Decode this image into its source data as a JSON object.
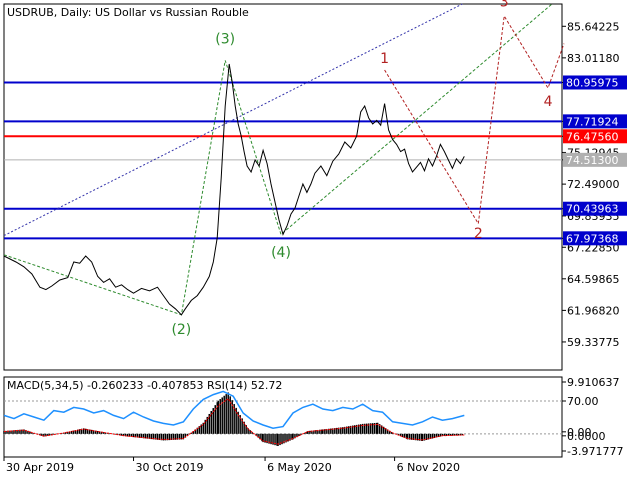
{
  "header": {
    "title": "USDRUB, Daily:  US Dollar vs Russian Rouble"
  },
  "colors": {
    "background": "#ffffff",
    "price_line": "#000000",
    "level_blue": "#0000cc",
    "level_red": "#ff0000",
    "current_grey": "#b0b0b0",
    "wave_green": "#2e8b2e",
    "wave_red": "#b22222",
    "channel_purple": "#3333aa",
    "rsi_blue": "#1e90ff",
    "macd_hist": "#000000",
    "macd_signal": "#ff0000"
  },
  "chart_data": [
    {
      "type": "line",
      "name": "price",
      "ylim": [
        57.0,
        87.5
      ],
      "x_ticks": [
        "30 Apr 2019",
        "30 Oct 2019",
        "6 May 2020",
        "6 Nov 2020"
      ],
      "y_ticks": [
        85.64225,
        83.0118,
        80.95975,
        77.71924,
        76.4756,
        75.12945,
        74.513,
        72.49,
        70.43963,
        69.83935,
        67.97368,
        67.2285,
        64.59865,
        61.9682,
        59.33775
      ],
      "series": [
        {
          "values": [
            [
              0,
              66.5
            ],
            [
              12,
              66.0
            ],
            [
              20,
              65.6
            ],
            [
              28,
              65.0
            ],
            [
              36,
              63.9
            ],
            [
              42,
              63.7
            ],
            [
              48,
              64.0
            ],
            [
              56,
              64.5
            ],
            [
              64,
              64.7
            ],
            [
              70,
              66.0
            ],
            [
              76,
              65.9
            ],
            [
              82,
              66.5
            ],
            [
              88,
              66.0
            ],
            [
              94,
              64.8
            ],
            [
              100,
              64.3
            ],
            [
              106,
              64.6
            ],
            [
              112,
              63.9
            ],
            [
              118,
              64.1
            ],
            [
              124,
              63.7
            ],
            [
              130,
              63.4
            ],
            [
              138,
              63.8
            ],
            [
              146,
              63.6
            ],
            [
              154,
              63.9
            ],
            [
              160,
              63.2
            ],
            [
              166,
              62.5
            ],
            [
              172,
              62.1
            ],
            [
              178,
              61.6
            ],
            [
              182,
              62.1
            ],
            [
              188,
              62.8
            ],
            [
              194,
              63.2
            ],
            [
              200,
              63.9
            ],
            [
              206,
              64.8
            ],
            [
              210,
              66.0
            ],
            [
              214,
              68.0
            ],
            [
              218,
              73.0
            ],
            [
              222,
              79.0
            ],
            [
              226,
              82.5
            ],
            [
              229,
              81.0
            ],
            [
              232,
              79.0
            ],
            [
              235,
              77.5
            ],
            [
              238,
              76.5
            ],
            [
              241,
              75.2
            ],
            [
              244,
              74.0
            ],
            [
              248,
              73.5
            ],
            [
              252,
              74.5
            ],
            [
              256,
              74.0
            ],
            [
              260,
              75.3
            ],
            [
              264,
              74.2
            ],
            [
              268,
              72.5
            ],
            [
              272,
              71.0
            ],
            [
              276,
              69.5
            ],
            [
              280,
              68.3
            ],
            [
              284,
              69.0
            ],
            [
              288,
              70.0
            ],
            [
              292,
              70.5
            ],
            [
              296,
              71.5
            ],
            [
              300,
              72.5
            ],
            [
              304,
              71.8
            ],
            [
              308,
              72.5
            ],
            [
              312,
              73.4
            ],
            [
              318,
              74.0
            ],
            [
              324,
              73.2
            ],
            [
              330,
              74.4
            ],
            [
              336,
              75.0
            ],
            [
              342,
              76.0
            ],
            [
              348,
              75.5
            ],
            [
              354,
              76.5
            ],
            [
              358,
              78.5
            ],
            [
              362,
              79.0
            ],
            [
              366,
              78.0
            ],
            [
              370,
              77.5
            ],
            [
              374,
              77.8
            ],
            [
              378,
              77.4
            ],
            [
              382,
              79.2
            ],
            [
              386,
              77.0
            ],
            [
              390,
              76.2
            ],
            [
              394,
              75.8
            ],
            [
              398,
              75.2
            ],
            [
              402,
              75.4
            ],
            [
              406,
              74.2
            ],
            [
              410,
              73.5
            ],
            [
              414,
              73.9
            ],
            [
              418,
              74.3
            ],
            [
              422,
              73.6
            ],
            [
              426,
              74.6
            ],
            [
              430,
              74.0
            ],
            [
              434,
              74.8
            ],
            [
              438,
              75.8
            ],
            [
              442,
              75.2
            ],
            [
              446,
              74.5
            ],
            [
              450,
              73.8
            ],
            [
              454,
              74.6
            ],
            [
              458,
              74.2
            ],
            [
              462,
              74.8
            ]
          ]
        }
      ],
      "levels": [
        {
          "value": 80.95975,
          "label": "80.95975",
          "style": "blue"
        },
        {
          "value": 77.71924,
          "label": "77.71924",
          "style": "blue"
        },
        {
          "value": 76.4756,
          "label": "76.47560",
          "style": "red"
        },
        {
          "value": 74.513,
          "label": "74.51300",
          "style": "grey"
        },
        {
          "value": 70.43963,
          "label": "70.43963",
          "style": "blue"
        },
        {
          "value": 67.97368,
          "label": "67.97368",
          "style": "blue"
        }
      ],
      "wave_labels_green": [
        {
          "text": "(2)",
          "x": 178,
          "y": 60.0
        },
        {
          "text": "(3)",
          "x": 222,
          "y": 84.2
        },
        {
          "text": "(4)",
          "x": 278,
          "y": 66.4
        }
      ],
      "wave_labels_red": [
        {
          "text": "1",
          "x": 382,
          "y": 82.6
        },
        {
          "text": "2",
          "x": 476,
          "y": 68.0
        },
        {
          "text": "3",
          "x": 502,
          "y": 87.3
        },
        {
          "text": "4",
          "x": 546,
          "y": 79.0
        }
      ],
      "wave_path_green": [
        [
          0,
          66.6
        ],
        [
          178,
          61.6
        ],
        [
          222,
          82.8
        ],
        [
          278,
          68.3
        ],
        [
          550,
          87.5
        ]
      ],
      "wave_path_red": [
        [
          382,
          82.0
        ],
        [
          476,
          69.2
        ],
        [
          502,
          86.5
        ],
        [
          546,
          80.5
        ],
        [
          562,
          84.2
        ]
      ],
      "channel_line": [
        [
          0,
          68.2
        ],
        [
          460,
          87.5
        ]
      ]
    },
    {
      "type": "line",
      "name": "indicators",
      "title": "MACD(5,34,5) -0.260233 -0.407853 RSI(14) 52.72",
      "ylim": [
        -4.2,
        10.3
      ],
      "y_ticks": [
        "9.910637",
        "70.00",
        "0.00",
        "0.0000",
        "-3.971777"
      ],
      "rsi_values": [
        [
          0,
          52
        ],
        [
          10,
          48
        ],
        [
          20,
          54
        ],
        [
          30,
          50
        ],
        [
          40,
          46
        ],
        [
          50,
          58
        ],
        [
          60,
          56
        ],
        [
          70,
          62
        ],
        [
          80,
          60
        ],
        [
          90,
          55
        ],
        [
          100,
          58
        ],
        [
          110,
          52
        ],
        [
          120,
          48
        ],
        [
          130,
          56
        ],
        [
          140,
          50
        ],
        [
          150,
          45
        ],
        [
          160,
          42
        ],
        [
          170,
          40
        ],
        [
          180,
          44
        ],
        [
          190,
          60
        ],
        [
          200,
          72
        ],
        [
          210,
          78
        ],
        [
          220,
          82
        ],
        [
          230,
          76
        ],
        [
          240,
          55
        ],
        [
          250,
          45
        ],
        [
          260,
          40
        ],
        [
          270,
          36
        ],
        [
          280,
          38
        ],
        [
          290,
          55
        ],
        [
          300,
          62
        ],
        [
          310,
          66
        ],
        [
          320,
          60
        ],
        [
          330,
          58
        ],
        [
          340,
          62
        ],
        [
          350,
          60
        ],
        [
          360,
          66
        ],
        [
          370,
          58
        ],
        [
          380,
          56
        ],
        [
          390,
          44
        ],
        [
          400,
          42
        ],
        [
          410,
          40
        ],
        [
          420,
          44
        ],
        [
          430,
          50
        ],
        [
          440,
          46
        ],
        [
          450,
          48
        ],
        [
          462,
          52
        ]
      ],
      "macd_values": [
        [
          0,
          0.5
        ],
        [
          20,
          0.8
        ],
        [
          40,
          -0.5
        ],
        [
          60,
          0.2
        ],
        [
          80,
          1.0
        ],
        [
          100,
          0.3
        ],
        [
          120,
          -0.4
        ],
        [
          140,
          -0.8
        ],
        [
          160,
          -1.2
        ],
        [
          180,
          -1.0
        ],
        [
          200,
          2.0
        ],
        [
          215,
          6.0
        ],
        [
          225,
          7.5
        ],
        [
          235,
          4.0
        ],
        [
          245,
          1.0
        ],
        [
          260,
          -1.5
        ],
        [
          275,
          -2.2
        ],
        [
          290,
          -1.0
        ],
        [
          305,
          0.5
        ],
        [
          320,
          0.8
        ],
        [
          340,
          1.2
        ],
        [
          360,
          1.8
        ],
        [
          375,
          2.0
        ],
        [
          390,
          0.2
        ],
        [
          405,
          -1.0
        ],
        [
          420,
          -1.3
        ],
        [
          440,
          -0.4
        ],
        [
          462,
          -0.26
        ]
      ]
    }
  ]
}
